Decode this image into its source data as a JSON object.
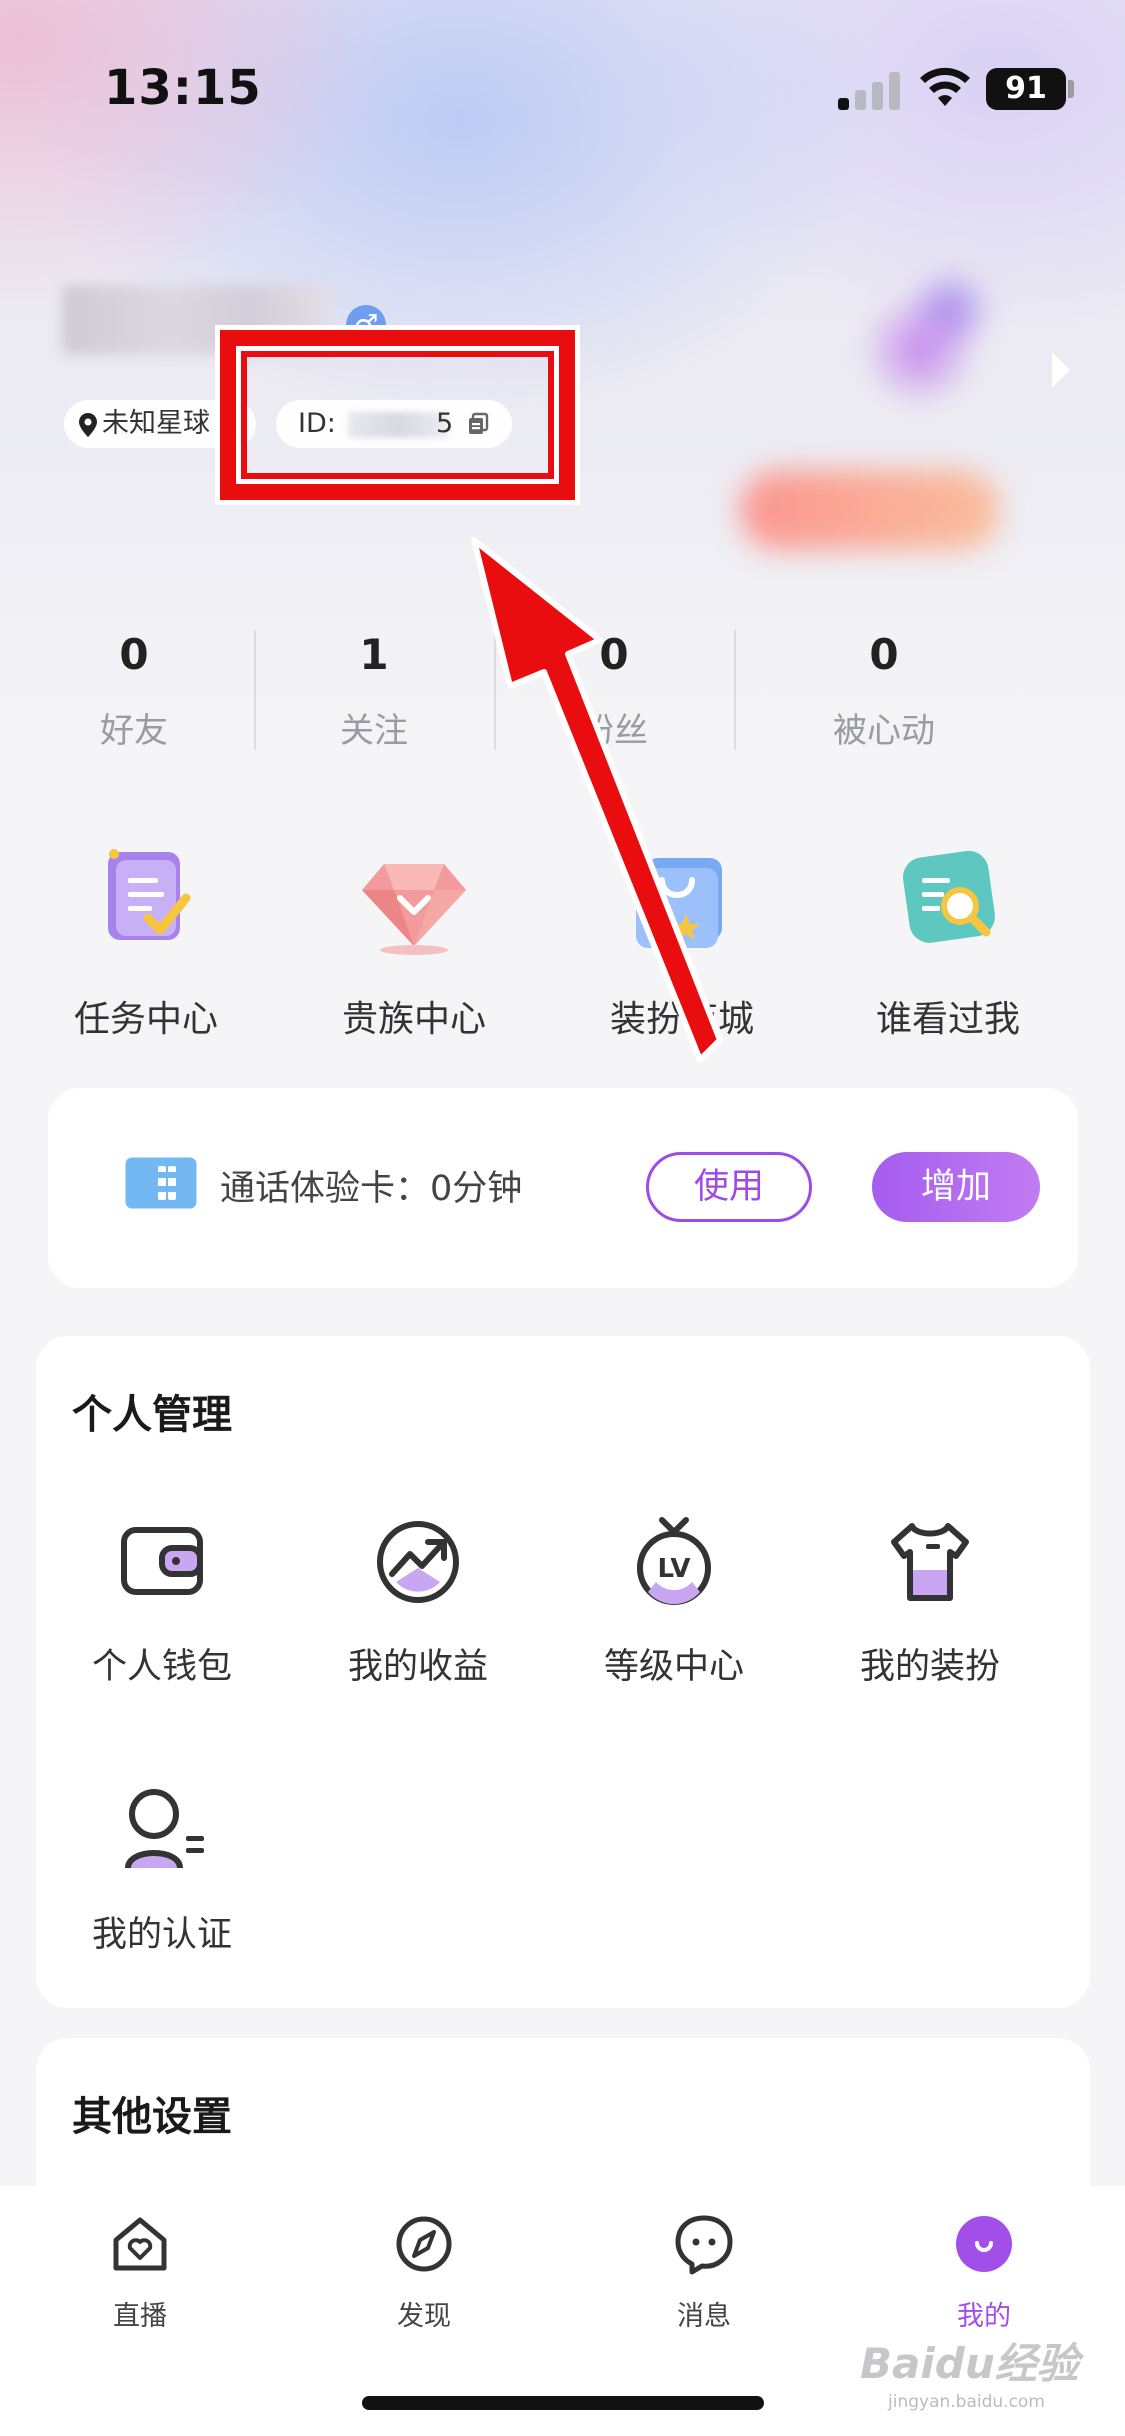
{
  "status_bar": {
    "time": "13:15",
    "battery": "91"
  },
  "profile": {
    "location": "未知星球",
    "id_prefix": "ID:",
    "id_tail": "5"
  },
  "stats": [
    {
      "value": "0",
      "label": "好友"
    },
    {
      "value": "1",
      "label": "关注"
    },
    {
      "value": "0",
      "label": "粉丝"
    },
    {
      "value": "0",
      "label": "被心动"
    }
  ],
  "features": [
    {
      "label": "任务中心",
      "icon": "task-icon"
    },
    {
      "label": "贵族中心",
      "icon": "diamond-icon"
    },
    {
      "label": "装扮商城",
      "icon": "shopping-bag-icon"
    },
    {
      "label": "谁看过我",
      "icon": "magnifier-icon"
    }
  ],
  "call_card": {
    "text": "通话体验卡：0分钟",
    "use_label": "使用",
    "add_label": "增加"
  },
  "management": {
    "title": "个人管理",
    "items": [
      {
        "label": "个人钱包",
        "icon": "wallet-icon"
      },
      {
        "label": "我的收益",
        "icon": "trend-icon"
      },
      {
        "label": "等级中心",
        "icon": "level-icon"
      },
      {
        "label": "我的装扮",
        "icon": "shirt-icon"
      },
      {
        "label": "我的认证",
        "icon": "verify-user-icon"
      }
    ]
  },
  "other": {
    "title": "其他设置"
  },
  "tabbar": [
    {
      "label": "直播",
      "icon": "home-heart-icon",
      "active": false
    },
    {
      "label": "发现",
      "icon": "compass-icon",
      "active": false
    },
    {
      "label": "消息",
      "icon": "chat-icon",
      "active": false
    },
    {
      "label": "我的",
      "icon": "profile-smile-icon",
      "active": true
    }
  ],
  "watermark": {
    "brand": "Baidu经验",
    "url": "jingyan.baidu.com"
  },
  "colors": {
    "accent": "#a24fe9",
    "annotation": "#ea0d10"
  }
}
